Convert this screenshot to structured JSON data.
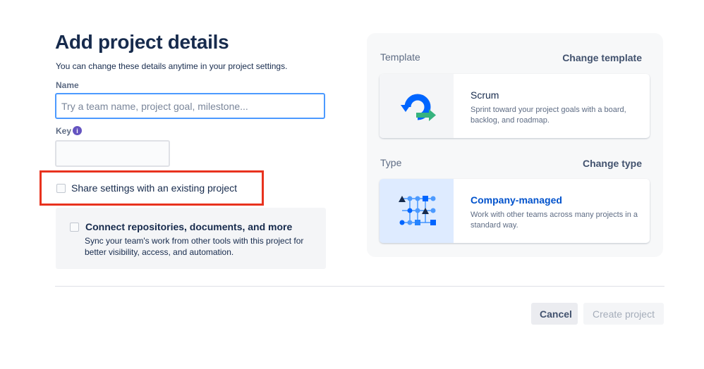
{
  "header": {
    "title": "Add project details",
    "subtitle": "You can change these details anytime in your project settings."
  },
  "form": {
    "name_label": "Name",
    "name_placeholder": "Try a team name, project goal, milestone...",
    "name_value": "",
    "key_label": "Key",
    "key_value": "",
    "info_icon_glyph": "i",
    "share_settings_label": "Share settings with an existing project",
    "share_settings_checked": false,
    "connect": {
      "title": "Connect repositories, documents, and more",
      "description": "Sync your team's work from other tools with this project for better visibility, access, and automation.",
      "checked": false
    }
  },
  "template": {
    "section_label": "Template",
    "change_label": "Change template",
    "card": {
      "icon": "scrum-cycle-icon",
      "title": "Scrum",
      "description": "Sprint toward your project goals with a board, backlog, and roadmap."
    }
  },
  "type": {
    "section_label": "Type",
    "change_label": "Change type",
    "card": {
      "icon": "company-managed-icon",
      "title": "Company-managed",
      "description": "Work with other teams across many projects in a standard way."
    }
  },
  "footer": {
    "cancel_label": "Cancel",
    "create_label": "Create project"
  },
  "colors": {
    "highlight": "#e8321e",
    "link_blue": "#0052cc",
    "input_focus": "#4c9aff",
    "info_purple": "#6554c0"
  }
}
